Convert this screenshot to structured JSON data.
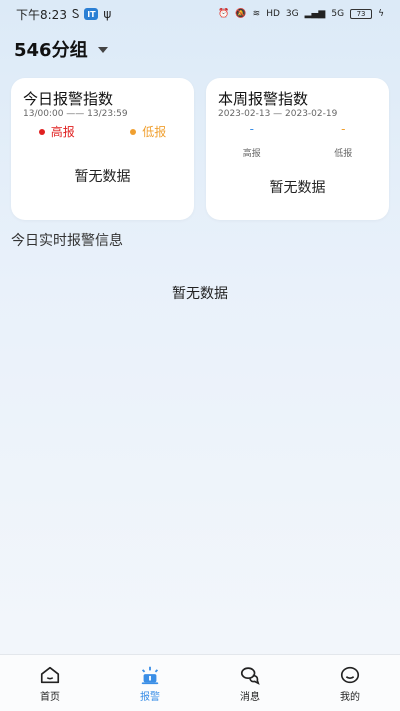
{
  "status_bar": {
    "time": "下午8:23",
    "badge": "IT",
    "network": "HD",
    "signal_3g": "3G",
    "signal_5g": "5G",
    "battery": "73"
  },
  "header": {
    "group_name": "546分组"
  },
  "today_card": {
    "title": "今日报警指数",
    "range": "13/00:00 —— 13/23:59",
    "high_label": "高报",
    "low_label": "低报",
    "empty": "暂无数据"
  },
  "week_card": {
    "title": "本周报警指数",
    "range": "2023-02-13 — 2023-02-19",
    "high_value": "-",
    "low_value": "-",
    "high_label": "高报",
    "low_label": "低报",
    "empty": "暂无数据"
  },
  "realtime": {
    "title": "今日实时报警信息",
    "empty": "暂无数据"
  },
  "tabs": [
    {
      "label": "首页",
      "icon": "home-icon",
      "active": false
    },
    {
      "label": "报警",
      "icon": "alarm-icon",
      "active": true
    },
    {
      "label": "消息",
      "icon": "message-icon",
      "active": false
    },
    {
      "label": "我的",
      "icon": "profile-icon",
      "active": false
    }
  ],
  "colors": {
    "accent": "#3a8ee6",
    "high": "#e02020",
    "low": "#f0a030"
  }
}
